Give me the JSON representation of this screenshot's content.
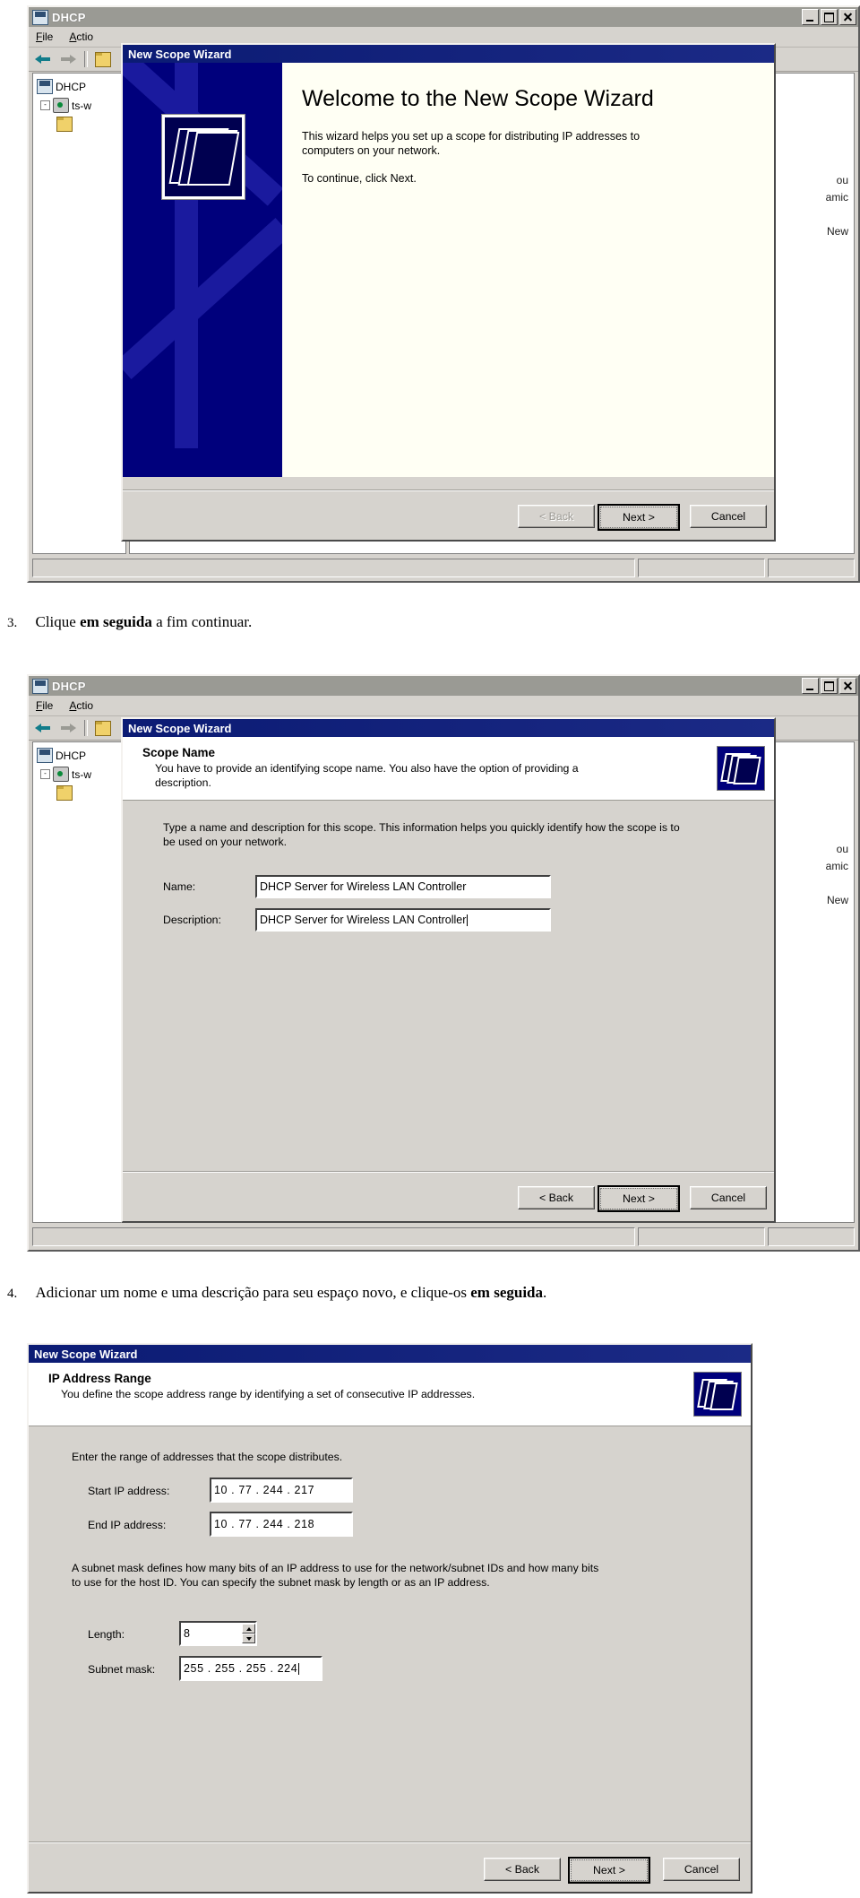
{
  "console": {
    "title": "DHCP",
    "title_icon": "dhcp-server-icon",
    "window_buttons": [
      "minimize",
      "maximize",
      "close"
    ],
    "menu": [
      "File",
      "Action"
    ],
    "toolbar_icons": [
      "back-arrow-icon",
      "forward-arrow-icon",
      "up-folder-icon"
    ],
    "tree": [
      {
        "label": "DHCP",
        "icon": "dhcp-icon",
        "indent": 0,
        "expander": ""
      },
      {
        "label": "ts-w",
        "icon": "server-icon",
        "indent": 1,
        "expander": "-"
      },
      {
        "label": "",
        "icon": "folder-icon",
        "indent": 2,
        "expander": ""
      }
    ],
    "list_fragments": [
      "ou",
      "amic",
      "New"
    ],
    "status_panes": [
      "",
      "",
      ""
    ]
  },
  "wizard1": {
    "title": "New Scope Wizard",
    "heading": "Welcome to the New Scope Wizard",
    "paragraphs": [
      "This wizard helps you set up a scope for distributing IP addresses to computers on your network.",
      "To continue, click Next."
    ],
    "buttons": {
      "back": "< Back",
      "next": "Next >",
      "cancel": "Cancel"
    }
  },
  "caption3": {
    "number": "3.",
    "before": "Clique ",
    "bold": "em seguida",
    "after": " a fim continuar."
  },
  "wizard2": {
    "title": "New Scope Wizard",
    "heading": "Scope Name",
    "subheading": "You have to provide an identifying scope name. You also have the option of providing a description.",
    "intro": "Type a name and description for this scope. This information helps you quickly identify how the scope is to be used on your network.",
    "fields": [
      {
        "label": "Name:",
        "value": "DHCP Server for Wireless LAN Controller",
        "caret": false
      },
      {
        "label": "Description:",
        "value": "DHCP Server for Wireless LAN Controller",
        "caret": true
      }
    ],
    "buttons": {
      "back": "< Back",
      "next": "Next >",
      "cancel": "Cancel"
    }
  },
  "caption4": {
    "number": "4.",
    "before": "Adicionar um nome e uma descrição para seu espaço novo, e clique-os ",
    "bold": "em seguida",
    "after": "."
  },
  "wizard3": {
    "title": "New Scope Wizard",
    "heading": "IP Address Range",
    "subheading": "You define the scope address range by identifying a set of consecutive IP addresses.",
    "range_intro": "Enter the range of addresses that the scope distributes.",
    "start_label": "Start IP address:",
    "start_value": "10 . 77 . 244 . 217",
    "end_label": "End IP address:",
    "end_value": "10 . 77 . 244 . 218",
    "mask_intro": "A subnet mask defines how many bits of an IP address to use for the network/subnet IDs and how many bits to use for the host ID. You can specify the subnet mask by length or as an IP address.",
    "length_label": "Length:",
    "length_value": "8",
    "mask_label": "Subnet mask:",
    "mask_value": "255 . 255 . 255 . 224",
    "buttons": {
      "back": "< Back",
      "next": "Next >",
      "cancel": "Cancel"
    }
  },
  "colors": {
    "dialog_face": "#d6d3ce",
    "title_blue": "#0b1b74",
    "wizard_art": "#00007c",
    "mmc_title": "#9a9a94"
  }
}
